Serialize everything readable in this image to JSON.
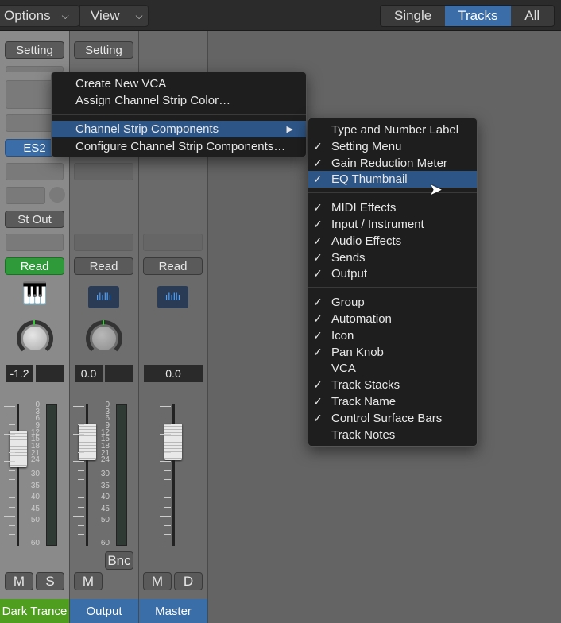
{
  "toolbar": {
    "options": "Options",
    "view": "View",
    "modes": [
      "Single",
      "Tracks",
      "All"
    ],
    "active_mode": "Tracks"
  },
  "strips": [
    {
      "setting": "Setting",
      "instrument": "ES2",
      "output": "St Out",
      "automation": "Read",
      "volume": "-1.2",
      "buttons": [
        "M",
        "S"
      ],
      "name": "Dark Trance",
      "name_color": "#4f9e1f"
    },
    {
      "setting": "Setting",
      "automation": "Read",
      "volume": "0.0",
      "bounce": "Bnc",
      "buttons": [
        "M"
      ],
      "name": "Output",
      "name_color": "#3a6ea8"
    },
    {
      "automation": "Read",
      "volume": "0.0",
      "buttons": [
        "M",
        "D"
      ],
      "name": "Master",
      "name_color": "#3a6ea8"
    }
  ],
  "meter_scale": [
    "0",
    "3",
    "6",
    "9",
    "12",
    "15",
    "18",
    "21",
    "24",
    "30",
    "35",
    "40",
    "45",
    "50",
    "60"
  ],
  "context_menu": {
    "items": [
      "Create New VCA",
      "Assign Channel Strip Color…",
      "Channel Strip Components",
      "Configure Channel Strip Components…"
    ],
    "highlighted": 2,
    "submenu_arrow": "▶"
  },
  "submenu": {
    "groups": [
      [
        {
          "label": "Type and Number Label",
          "checked": false
        },
        {
          "label": "Setting Menu",
          "checked": true
        },
        {
          "label": "Gain Reduction Meter",
          "checked": true
        },
        {
          "label": "EQ Thumbnail",
          "checked": true,
          "highlighted": true
        }
      ],
      [
        {
          "label": "MIDI Effects",
          "checked": true
        },
        {
          "label": "Input / Instrument",
          "checked": true
        },
        {
          "label": "Audio Effects",
          "checked": true
        },
        {
          "label": "Sends",
          "checked": true
        },
        {
          "label": "Output",
          "checked": true
        }
      ],
      [
        {
          "label": "Group",
          "checked": true
        },
        {
          "label": "Automation",
          "checked": true
        },
        {
          "label": "Icon",
          "checked": true
        },
        {
          "label": "Pan Knob",
          "checked": true
        },
        {
          "label": "VCA",
          "checked": false
        },
        {
          "label": "Track Stacks",
          "checked": true
        },
        {
          "label": "Track Name",
          "checked": true
        },
        {
          "label": "Control Surface Bars",
          "checked": true
        },
        {
          "label": "Track Notes",
          "checked": false
        }
      ]
    ],
    "check": "✓"
  }
}
